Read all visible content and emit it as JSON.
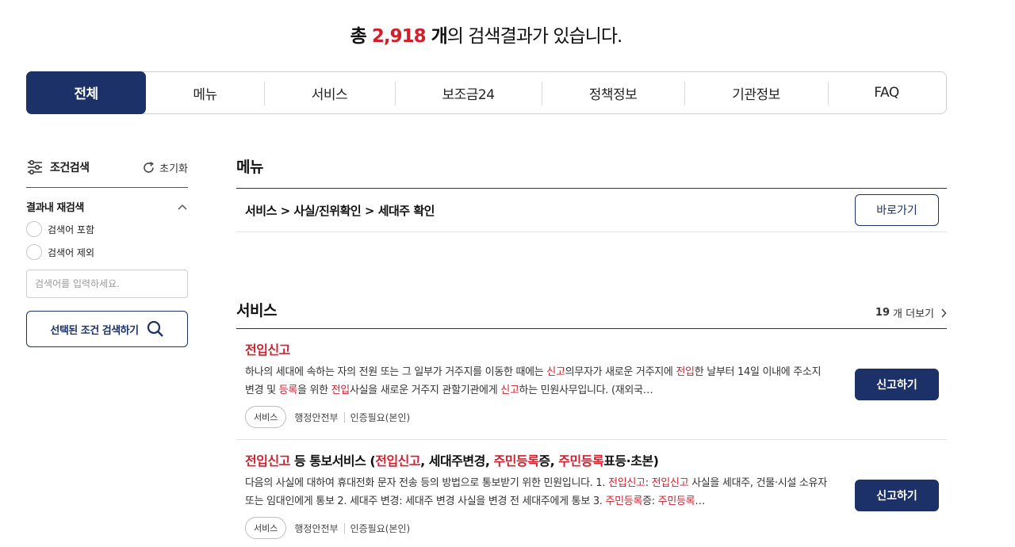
{
  "headline": {
    "prefix": "총 ",
    "count": "2,918",
    "unit": " 개",
    "suffix": "의 검색결과가 있습니다."
  },
  "tabs": [
    {
      "label": "전체",
      "active": true
    },
    {
      "label": "메뉴"
    },
    {
      "label": "서비스"
    },
    {
      "label": "보조금24"
    },
    {
      "label": "정책정보"
    },
    {
      "label": "기관정보"
    },
    {
      "label": "FAQ"
    }
  ],
  "sidebar": {
    "title": "조건검색",
    "reset_label": "초기화",
    "research_label": "결과내 재검색",
    "options": [
      "검색어 포함",
      "검색어 제외"
    ],
    "input_placeholder": "검색어를 입력하세요.",
    "search_button": "선택된 조건 검색하기"
  },
  "menu_section": {
    "title": "메뉴",
    "path": "서비스 > 사실/진위확인 > 세대주 확인",
    "button": "바로가기"
  },
  "service_section": {
    "title": "서비스",
    "more_count": "19",
    "more_label": "개 더보기",
    "items": [
      {
        "title_parts": [
          {
            "t": "전입신고",
            "hl": true
          }
        ],
        "desc_parts": [
          {
            "t": "하나의 세대에 속하는 자의 전원 또는 그 일부가 거주지를 이동한 때에는 "
          },
          {
            "t": "신고",
            "hl": true
          },
          {
            "t": "의무자가 새로운 거주지에 "
          },
          {
            "t": "전입",
            "hl": true
          },
          {
            "t": "한 날부터 14일 이내에 주소지변경 및 "
          },
          {
            "t": "등록",
            "hl": true
          },
          {
            "t": "을 위한 "
          },
          {
            "t": "전입",
            "hl": true
          },
          {
            "t": "사실을 새로운 거주지 관할기관에게 "
          },
          {
            "t": "신고",
            "hl": true
          },
          {
            "t": "하는 민원사무입니다. (재외국…"
          }
        ],
        "chip": "서비스",
        "agency": "행정안전부",
        "auth": "인증필요(본인)",
        "button": "신고하기"
      },
      {
        "title_parts": [
          {
            "t": "전입신고",
            "hl": true
          },
          {
            "t": " 등 통보서비스 ("
          },
          {
            "t": "전입신고",
            "hl": true
          },
          {
            "t": ", 세대주변경, "
          },
          {
            "t": "주민등록",
            "hl": true
          },
          {
            "t": "증, "
          },
          {
            "t": "주민등록",
            "hl": true
          },
          {
            "t": "표등·초본)"
          }
        ],
        "desc_parts": [
          {
            "t": "다음의 사실에 대하여 휴대전화 문자 전송 등의 방법으로 통보받기 위한 민원입니다. 1. "
          },
          {
            "t": "전입신고",
            "hl": true
          },
          {
            "t": ": "
          },
          {
            "t": "전입신고",
            "hl": true
          },
          {
            "t": " 사실을 세대주, 건물·시설 소유자 또는 임대인에게 통보 2. 세대주 변경: 세대주 변경 사실을 변경 전 세대주에게 통보 3. "
          },
          {
            "t": "주민등록",
            "hl": true
          },
          {
            "t": "증: "
          },
          {
            "t": "주민등록",
            "hl": true
          },
          {
            "t": "…"
          }
        ],
        "chip": "서비스",
        "agency": "행정안전부",
        "auth": "인증필요(본인)",
        "button": "신고하기"
      }
    ]
  },
  "colors": {
    "brand_navy": "#1c3168",
    "highlight_red": "#d11f2e"
  }
}
